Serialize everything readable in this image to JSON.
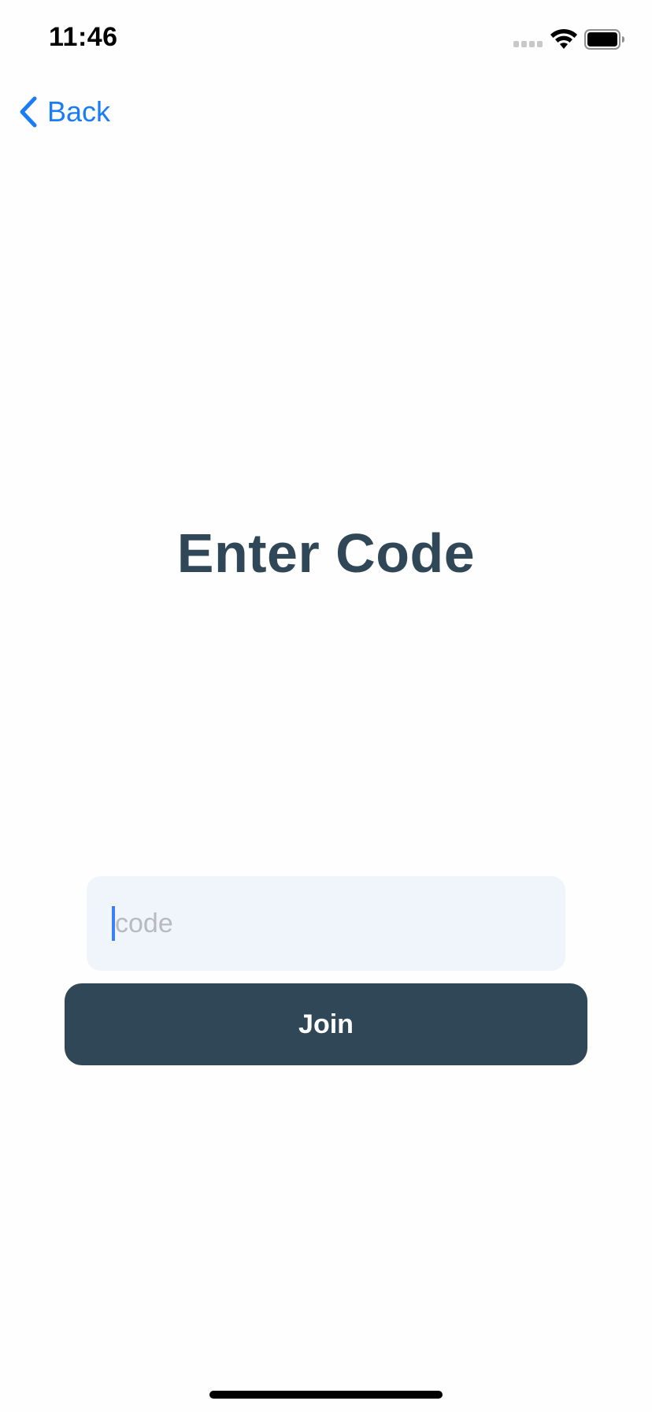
{
  "status_bar": {
    "time": "11:46",
    "icons": [
      "cellular-signal-icon",
      "wifi-icon",
      "battery-icon"
    ]
  },
  "nav": {
    "back_label": "Back",
    "back_icon": "chevron-left-icon",
    "accent_color": "#1a7cf6"
  },
  "main": {
    "title": "Enter Code",
    "code_input": {
      "value": "",
      "placeholder": "code"
    },
    "join_label": "Join"
  },
  "colors": {
    "primary": "#2f4757",
    "input_background": "#eff5fa",
    "caret": "#3d7ff5"
  }
}
